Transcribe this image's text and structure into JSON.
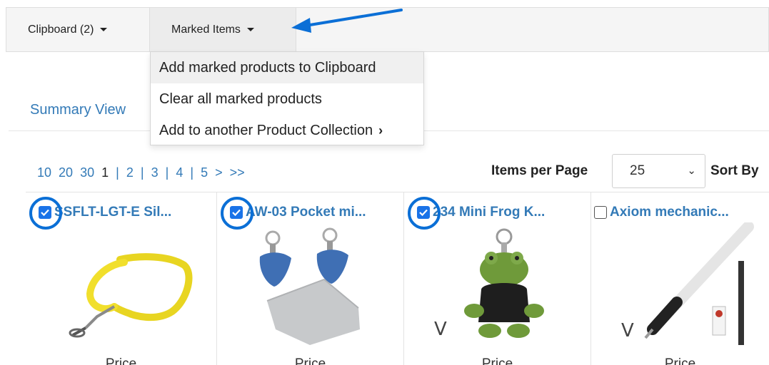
{
  "toolbar": {
    "clipboard_label": "Clipboard (2)",
    "marked_items_label": "Marked Items"
  },
  "marked_menu": {
    "items": [
      "Add marked products to Clipboard",
      "Clear all marked products",
      "Add to another Product Collection"
    ]
  },
  "summary_view_label": "Summary View",
  "pager": {
    "page_sizes": [
      "10",
      "20",
      "30"
    ],
    "current_page": "1",
    "pages": [
      "2",
      "3",
      "4",
      "5"
    ],
    "next": ">",
    "last": ">>",
    "separator": "|"
  },
  "items_per_page": {
    "label": "Items per Page",
    "value": "25"
  },
  "sort_by_label": "Sort By",
  "products": [
    {
      "name": "SSFLT-LGT-E  Sil...",
      "checked": true,
      "price_label": "Price"
    },
    {
      "name": "AW-03  Pocket mi...",
      "checked": true,
      "price_label": "Price"
    },
    {
      "name": "234  Mini Frog K...",
      "checked": true,
      "price_label": "Price"
    },
    {
      "name": "Axiom mechanic...",
      "checked": false,
      "price_label": "Price"
    }
  ],
  "colors": {
    "link": "#337ab7",
    "checkbox": "#1a73e8",
    "annotation": "#0b6fd6"
  },
  "icons": {
    "caret": "caret-down-icon",
    "arrow": "annotation-arrow",
    "chevron": "chevron-right-icon",
    "select": "chevron-down-icon"
  }
}
